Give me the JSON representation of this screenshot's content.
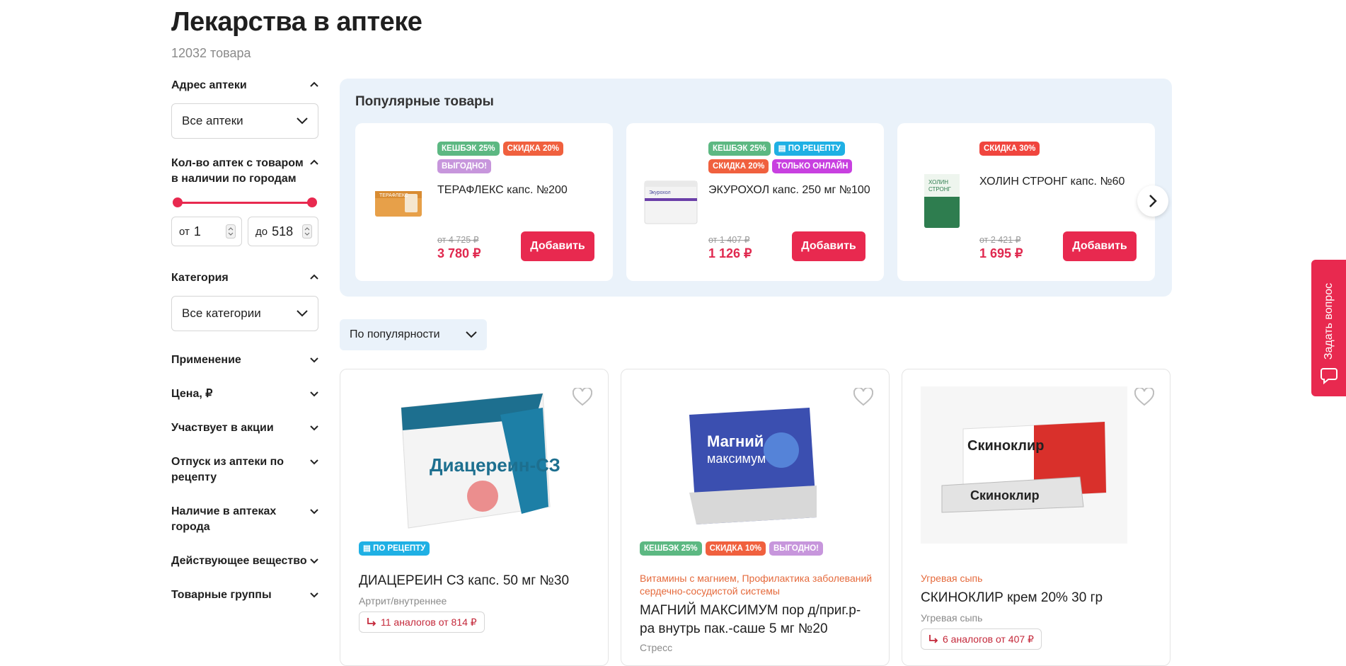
{
  "page": {
    "title": "Лекарства в аптеке",
    "count": "12032 товара"
  },
  "filters": {
    "address": {
      "label": "Адрес аптеки",
      "value": "Все аптеки"
    },
    "pharmacies": {
      "label": "Кол-во аптек с товаром в наличии по городам",
      "from_label": "от",
      "from_value": "1",
      "to_label": "до",
      "to_value": "518"
    },
    "category": {
      "label": "Категория",
      "value": "Все категории"
    },
    "collapsed": [
      "Применение",
      "Цена, ₽",
      "Участвует в акции",
      "Отпуск из аптеки по рецепту",
      "Наличие в аптеках города",
      "Действующее вещество",
      "Товарные группы"
    ]
  },
  "popular": {
    "title": "Популярные товары",
    "items": [
      {
        "badges": [
          "КЕШБЭК 25%",
          "СКИДКА 20%",
          "ВЫГОДНО!"
        ],
        "name": "ТЕРАФЛЕКС капс. №200",
        "old_price": "от 4 725 ₽",
        "price": "3 780 ₽",
        "button": "Добавить"
      },
      {
        "badges": [
          "КЕШБЭК 25%",
          "ПО РЕЦЕПТУ",
          "СКИДКА 20%",
          "ТОЛЬКО ОНЛАЙН"
        ],
        "name": "ЭКУРОХОЛ капс. 250 мг №100",
        "old_price": "от 1 407 ₽",
        "price": "1 126 ₽",
        "button": "Добавить"
      },
      {
        "badges": [
          "СКИДКА 30%"
        ],
        "name": "ХОЛИН СТРОНГ капс. №60",
        "old_price": "от 2 421 ₽",
        "price": "1 695 ₽",
        "button": "Добавить"
      }
    ],
    "next_icon": "chevron-right-icon"
  },
  "sort": {
    "value": "По популярности"
  },
  "products": [
    {
      "badges": [
        "ПО РЕЦЕПТУ"
      ],
      "category": "",
      "name": "ДИАЦЕРЕИН СЗ капс. 50 мг №30",
      "subtitle": "Артрит/внутреннее",
      "analogs": "11 аналогов от 814 ₽"
    },
    {
      "badges": [
        "КЕШБЭК 25%",
        "СКИДКА 10%",
        "ВЫГОДНО!"
      ],
      "category": "Витамины с магнием, Профилактика заболеваний сердечно-сосудистой системы",
      "name": "МАГНИЙ МАКСИМУМ пор д/приг.р-ра внутрь пак.-саше 5 мг №20",
      "subtitle": "Стресс",
      "analogs": ""
    },
    {
      "badges": [],
      "category": "Угревая сыпь",
      "name": "СКИНОКЛИР крем 20% 30 гр",
      "subtitle": "Угревая сыпь",
      "analogs": "6 аналогов от 407 ₽"
    }
  ],
  "ask": {
    "label": "Задать вопрос"
  },
  "colors": {
    "accent": "#e8294f",
    "panel": "#eaf2fa"
  }
}
